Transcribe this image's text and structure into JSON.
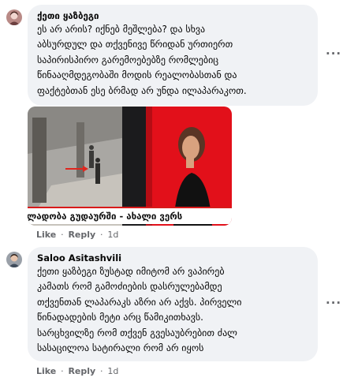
{
  "comments": [
    {
      "author": "ქეთი ყაზბეგი",
      "lines": [
        "ეს არ არის? იქნებ მეშლება? და სხვა",
        "აბსურდულ და თქვენივე წრიდან ურთიერთ",
        "საპირისპირო გარემოებებზე რომლებიც",
        "წინააღმდეგობაში მოდის რეალობასთან და",
        "ფაქტებთან ესე ბრმად არ უნდა ილაპარაკოთ."
      ],
      "media_caption": "ძალადობა გუდაურში - ახალი ვერს",
      "actions": {
        "like": "Like",
        "reply": "Reply",
        "separator": "·",
        "time": "1d"
      },
      "more_glyph": "···"
    },
    {
      "author": "Saloo Asitashvili",
      "lines": [
        "ქეთი ყაზბეგი ზუსტად იმიტომ არ ვაპირებ",
        "კამათს რომ გამოძიების დასრულებამდე",
        "თქვენთან ლაპარაკს აზრი არ აქვს. პირველი",
        "წინადადების მეტი არც წამიკითხავს.",
        "სარცხვილზე რომ თქვენ გვესაუბრებით ძალ",
        "სასაცილოა სატირალი რომ არ იყოს"
      ],
      "actions": {
        "like": "Like",
        "reply": "Reply",
        "separator": "·",
        "time": "1d"
      },
      "more_glyph": "···"
    }
  ],
  "colors": {
    "bubble": "#f0f2f5",
    "muted": "#65676b",
    "ticker_red": "#d81a1a",
    "studio_red": "#e2101a"
  }
}
